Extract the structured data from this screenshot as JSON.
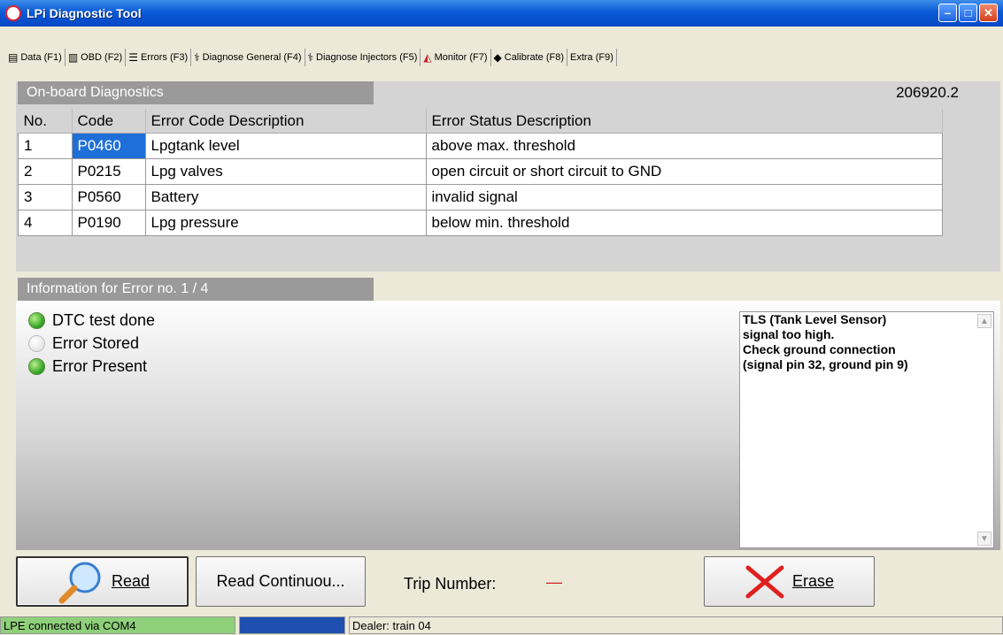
{
  "window": {
    "title": "LPi Diagnostic Tool"
  },
  "tabs": [
    {
      "label": "Data (F1)",
      "icon": "data-icon"
    },
    {
      "label": "OBD (F2)",
      "icon": "obd-icon"
    },
    {
      "label": "Errors (F3)",
      "icon": "errors-icon"
    },
    {
      "label": "Diagnose General (F4)",
      "icon": "stethoscope-icon"
    },
    {
      "label": "Diagnose Injectors (F5)",
      "icon": "stethoscope-icon"
    },
    {
      "label": "Monitor (F7)",
      "icon": "monitor-icon"
    },
    {
      "label": "Calibrate (F8)",
      "icon": "calibrate-icon"
    },
    {
      "label": "Extra (F9)",
      "icon": ""
    }
  ],
  "obd": {
    "section_title": "On-board Diagnostics",
    "version": "206920.2",
    "columns": [
      "No.",
      "Code",
      "Error Code Description",
      "Error Status Description"
    ],
    "rows": [
      {
        "no": "1",
        "code": "P0460",
        "desc": "Lpgtank level",
        "status": "above max. threshold"
      },
      {
        "no": "2",
        "code": "P0215",
        "desc": "Lpg valves",
        "status": "open circuit or short circuit to GND"
      },
      {
        "no": "3",
        "code": "P0560",
        "desc": "Battery",
        "status": "invalid signal"
      },
      {
        "no": "4",
        "code": "P0190",
        "desc": "Lpg pressure",
        "status": "below min. threshold"
      }
    ]
  },
  "info": {
    "section_title": "Information for Error no. 1 / 4",
    "indicators": [
      {
        "label": "DTC test done",
        "on": true
      },
      {
        "label": "Error Stored",
        "on": false
      },
      {
        "label": "Error Present",
        "on": true
      }
    ],
    "message": "TLS (Tank Level Sensor)\nsignal too high.\nCheck ground connection\n(signal pin 32, ground pin 9)"
  },
  "actions": {
    "read_label": "Read",
    "read_continuous_label": "Read Continuou...",
    "trip_label": "Trip Number:",
    "trip_value": "—",
    "erase_label": "Erase"
  },
  "status": {
    "connection": "LPE connected via COM4",
    "dealer": "Dealer: train 04",
    "connection_color": "#8fd07a",
    "progress_color": "#1f4fb0"
  }
}
